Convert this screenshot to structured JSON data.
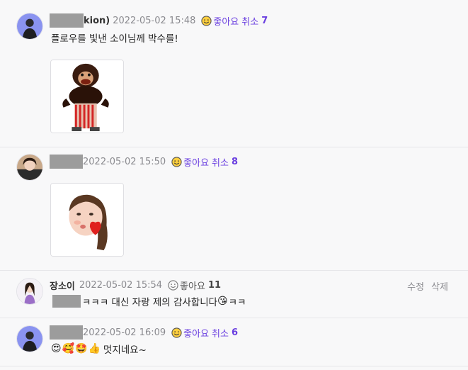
{
  "comments": [
    {
      "author": "kion)",
      "time": "2022-05-02 15:48",
      "like_label": "좋아요",
      "cancel_label": "취소",
      "like_count": "7",
      "text": "플로우를 빛낸 소이님께 박수를!"
    },
    {
      "author": "",
      "time": "2022-05-02 15:50",
      "like_label": "좋아요",
      "cancel_label": "취소",
      "like_count": "8"
    },
    {
      "author": "장소이",
      "time": "2022-05-02 15:54",
      "like_label": "좋아요",
      "like_count": "11",
      "text": "ㅋㅋㅋ 대신 자랑 제의 감사합니다",
      "text_suffix": "ㅋㅋ",
      "edit_label": "수정",
      "delete_label": "삭제"
    },
    {
      "author": "",
      "time": "2022-05-02 16:09",
      "like_label": "좋아요",
      "cancel_label": "취소",
      "like_count": "6",
      "text": "멋지네요~"
    }
  ],
  "colors": {
    "accent": "#6a3fe0",
    "meta": "#8a8a8f",
    "divider": "#e6e6e9"
  },
  "icons": [
    "smile-icon",
    "monkey-sticker",
    "memoji-sticker",
    "kissing-heart-emoji",
    "heart-eyes-emoji",
    "smiling-hearts-emoji",
    "star-struck-emoji",
    "thumbs-up-emoji"
  ]
}
